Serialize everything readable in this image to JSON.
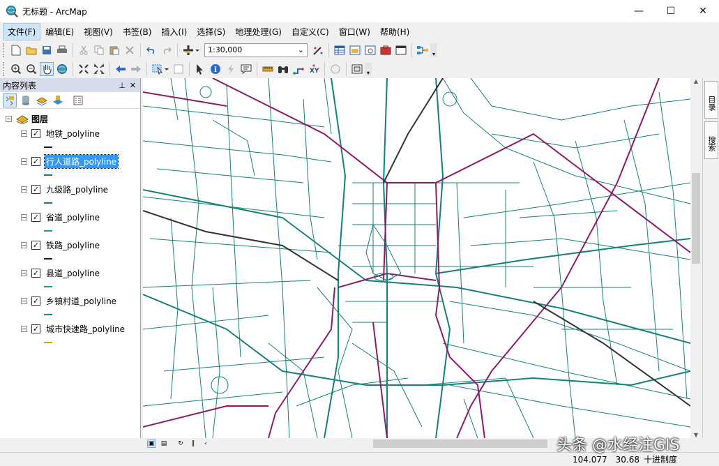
{
  "window": {
    "title": "无标题 - ArcMap"
  },
  "menu": [
    {
      "label": "文件(F)",
      "active": true
    },
    {
      "label": "编辑(E)"
    },
    {
      "label": "视图(V)"
    },
    {
      "label": "书签(B)"
    },
    {
      "label": "插入(I)"
    },
    {
      "label": "选择(S)"
    },
    {
      "label": "地理处理(G)"
    },
    {
      "label": "自定义(C)"
    },
    {
      "label": "窗口(W)"
    },
    {
      "label": "帮助(H)"
    }
  ],
  "toolbar": {
    "scale_value": "1:30,000"
  },
  "toc": {
    "title": "内容列表",
    "root_label": "图层",
    "layers": [
      {
        "name": "地铁_polyline",
        "checked": true,
        "color": "#1a1a1a",
        "selected": false
      },
      {
        "name": "行人道路_polyline",
        "checked": true,
        "color": "#1a7a7a",
        "selected": true
      },
      {
        "name": "九级路_polyline",
        "checked": true,
        "color": "#1a7a7a",
        "selected": false
      },
      {
        "name": "省道_polyline",
        "checked": true,
        "color": "#1a9a9a",
        "selected": false
      },
      {
        "name": "铁路_polyline",
        "checked": true,
        "color": "#1a1a1a",
        "selected": false
      },
      {
        "name": "县道_polyline",
        "checked": true,
        "color": "#1a9a8a",
        "selected": false
      },
      {
        "name": "乡镇村道_polyline",
        "checked": true,
        "color": "#1a8a7a",
        "selected": false
      },
      {
        "name": "城市快速路_polyline",
        "checked": true,
        "color": "#d4a017",
        "selected": false
      }
    ]
  },
  "side_tabs": [
    "目录",
    "搜索"
  ],
  "status": {
    "x": "104.077",
    "y": "30.68",
    "units": "十进制度"
  },
  "watermark": "头条 @水经注GIS",
  "colors": {
    "road": "#14807a",
    "highway": "#8b1a6b",
    "rail": "#333333"
  }
}
